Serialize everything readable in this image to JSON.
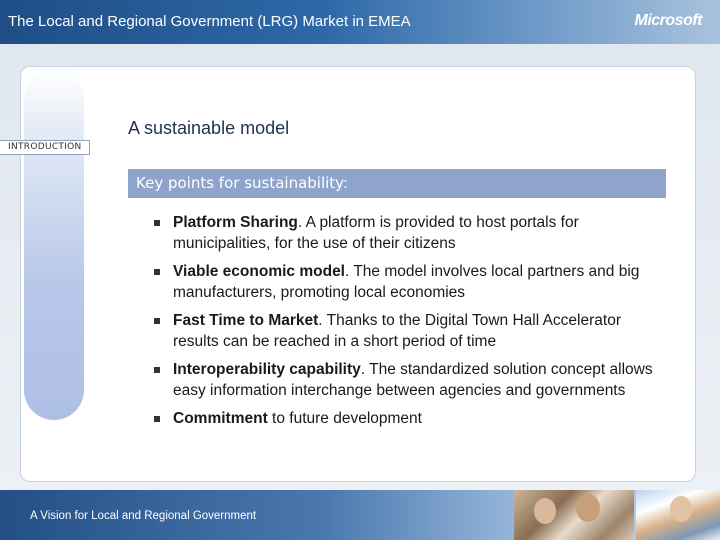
{
  "header": {
    "title": "The Local and Regional Government (LRG) Market in EMEA",
    "logo_text": "Microsoft",
    "logo_mark": "®"
  },
  "section_tag": "INTRODUCTION",
  "heading": "A sustainable model",
  "key_points_label": "Key points for sustainability:",
  "bullets": [
    {
      "bold": "Platform Sharing",
      "rest": ". A platform is provided to host portals for municipalities, for the use of their citizens"
    },
    {
      "bold": "Viable economic model",
      "rest": ". The model involves local partners and big manufacturers, promoting local economies"
    },
    {
      "bold": "Fast Time to Market",
      "rest": ". Thanks to the Digital Town Hall Accelerator results can be reached in a short period of time"
    },
    {
      "bold": "Interoperability capability",
      "rest": ". The standardized solution concept allows easy information interchange between agencies and governments"
    },
    {
      "bold": "Commitment",
      "rest": " to future development"
    }
  ],
  "footer": {
    "tagline": "A Vision for Local and Regional Government"
  },
  "colors": {
    "header_blue": "#1f4e86",
    "key_box": "#8ea4cc",
    "footer_blue": "#234f86"
  }
}
